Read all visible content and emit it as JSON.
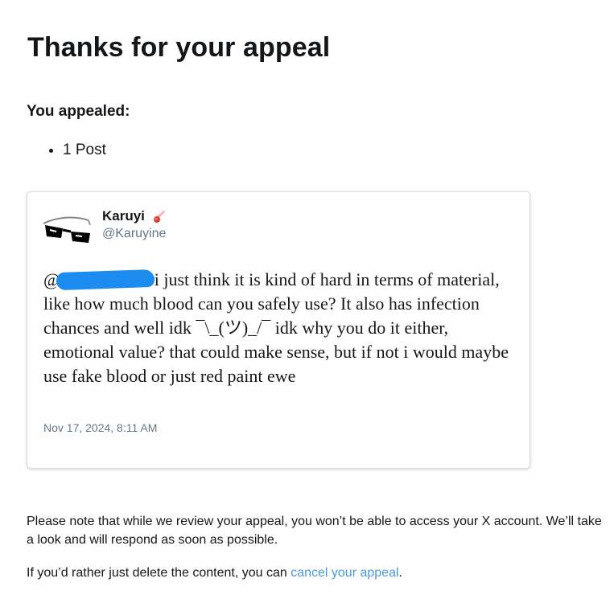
{
  "page": {
    "title": "Thanks for your appeal",
    "appealed_label": "You appealed:",
    "appealed_items": [
      "1 Post"
    ]
  },
  "tweet": {
    "author_name": "Karuyi",
    "author_badge_icon": "meteor-icon",
    "author_handle": "@Karuyine",
    "mention_prefix": "@",
    "text_after_mention": "i just think it is kind of hard in terms of material, like how much blood can you safely use? It also has infection chances and well idk ¯\\_(ツ)_/¯ idk why you do it either, emotional value? that could make sense, but if not i would maybe use fake blood or just red paint ewe",
    "timestamp": "Nov 17, 2024, 8:11 AM"
  },
  "notice": {
    "line1": "Please note that while we review your appeal, you won’t be able to access your X account. We’ll take a look and will respond as soon as possible.",
    "line2_prefix": "If you’d rather just delete the content, you can ",
    "line2_link": "cancel your appeal",
    "line2_suffix": "."
  },
  "colors": {
    "link": "#4a99d8",
    "redaction": "#1d8cf0",
    "muted_text": "#657786"
  }
}
